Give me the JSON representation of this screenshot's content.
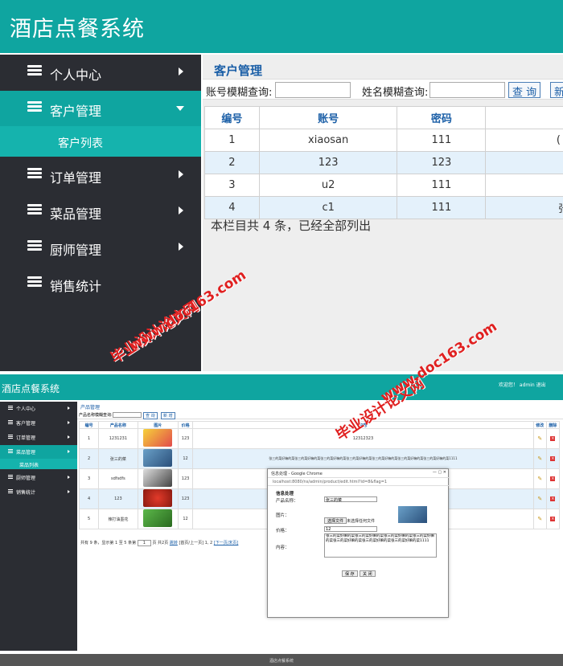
{
  "top": {
    "app_title": "酒店点餐系统",
    "sidebar": [
      {
        "label": "个人中心"
      },
      {
        "label": "客户管理"
      },
      {
        "label": "客户列表"
      },
      {
        "label": "订单管理"
      },
      {
        "label": "菜品管理"
      },
      {
        "label": "厨师管理"
      },
      {
        "label": "销售统计"
      }
    ],
    "page_title": "客户管理",
    "search": {
      "account_label": "账号模糊查询:",
      "name_label": "姓名模糊查询:",
      "query_btn": "查 询",
      "new_btn": "新"
    },
    "table": {
      "headers": [
        "编号",
        "账号",
        "密码"
      ],
      "rows": [
        [
          "1",
          "xiaosan",
          "111",
          "("
        ],
        [
          "2",
          "123",
          "123",
          ""
        ],
        [
          "3",
          "u2",
          "111",
          ""
        ],
        [
          "4",
          "c1",
          "111",
          "张"
        ]
      ]
    },
    "summary": "本栏目共 4 条，已经全部列出"
  },
  "bottom": {
    "app_title": "酒店点餐系统",
    "header_right": "欢迎您！  admin   退出",
    "sidebar": [
      {
        "label": "个人中心"
      },
      {
        "label": "客户管理"
      },
      {
        "label": "订单管理"
      },
      {
        "label": "菜品管理"
      },
      {
        "label": "菜品列表"
      },
      {
        "label": "厨师管理"
      },
      {
        "label": "销售统计"
      }
    ],
    "page_title": "产品管理",
    "search": {
      "label": "产品名称模糊查询:",
      "query": "查 询",
      "new": "新 增"
    },
    "table": {
      "headers": [
        "编号",
        "产品名称",
        "图片",
        "价格",
        "内容",
        "修改",
        "删除"
      ],
      "rows": [
        [
          "1",
          "1231231",
          "123",
          "12312323"
        ],
        [
          "2",
          "张三的菜",
          "12",
          "张三的菜好嘛的菜张三的菜好嘛的菜张三的菜好嘛的菜张三的菜好嘛的菜张三的菜好嘛的菜张三的菜好嘛的菜张三的菜好嘛的菜1111"
        ],
        [
          "3",
          "sdfsdfs",
          "123",
          ""
        ],
        [
          "4",
          "123",
          "123",
          ""
        ],
        [
          "5",
          "辣打油墨花",
          "12",
          ""
        ]
      ]
    },
    "pager": {
      "info": "共有 9 条，显示第 1 至 5 条第",
      "page_input": "1",
      "info2": "页 共2页",
      "jump": "跳转",
      "nav": "[首页/上一页]",
      "pages": "1, 2",
      "next": "[下一页/末页]"
    },
    "footer": "酒店点餐系统",
    "popup": {
      "title_bar": "信息处理 - Google Chrome",
      "url": "localhost:8080/ns/admin/product/edit.html?id=8&flag=1",
      "heading": "信息处理",
      "name_label": "产品名称：",
      "name_value": "张三的菜",
      "img_label": "图片：",
      "file_btn": "选择文件",
      "file_status": "未选择任何文件",
      "price_label": "价格：",
      "price_value": "12",
      "content_label": "内容：",
      "content_value": "张三的菜好嘛的菜张三的菜好嘛的菜张三的菜好嘛的菜张三的菜好嘛的菜张三的菜好嘛的菜张三的菜好嘛的菜张三的菜好嘛的菜1111",
      "save": "保 存",
      "close": "关 闭"
    }
  },
  "watermarks": {
    "url": "www.doc163.com",
    "site": "毕业设计论文网"
  },
  "colors": {
    "teal": "#0fa5a0",
    "sidebar": "#2b2d33",
    "link_blue": "#1b5fa7",
    "watermark": "#e02020"
  }
}
